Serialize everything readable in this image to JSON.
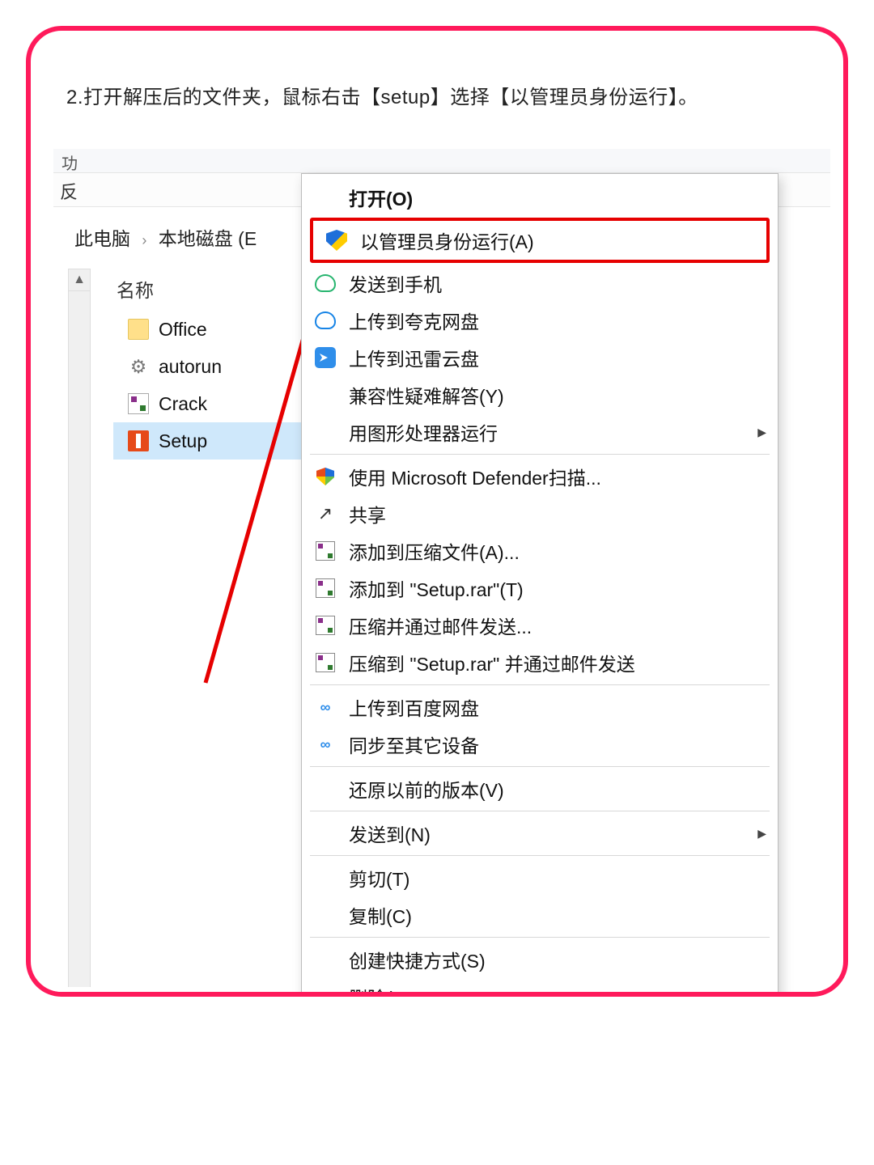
{
  "instruction": "2.打开解压后的文件夹，鼠标右击【setup】选择【以管理员身份运行】。",
  "top": {
    "frag1": "功",
    "frag2": "反"
  },
  "breadcrumb": {
    "pc": "此电脑",
    "drive": "本地磁盘 (E"
  },
  "column_header": "名称",
  "files": {
    "office": "Office",
    "autorun": "autorun",
    "crack": "Crack",
    "setup": "Setup"
  },
  "ctx": {
    "open": "打开(O)",
    "run_admin": "以管理员身份运行(A)",
    "send_phone": "发送到手机",
    "upload_quark": "上传到夸克网盘",
    "upload_xunlei": "上传到迅雷云盘",
    "compat": "兼容性疑难解答(Y)",
    "gpu": "用图形处理器运行",
    "defender": "使用 Microsoft Defender扫描...",
    "share": "共享",
    "add_archive": "添加到压缩文件(A)...",
    "add_setup_rar": "添加到 \"Setup.rar\"(T)",
    "zip_email": "压缩并通过邮件发送...",
    "zip_setup_email": "压缩到 \"Setup.rar\" 并通过邮件发送",
    "baidu_upload": "上传到百度网盘",
    "baidu_sync": "同步至其它设备",
    "restore": "还原以前的版本(V)",
    "send_to": "发送到(N)",
    "cut": "剪切(T)",
    "copy": "复制(C)",
    "shortcut": "创建快捷方式(S)",
    "delete": "删除("
  }
}
